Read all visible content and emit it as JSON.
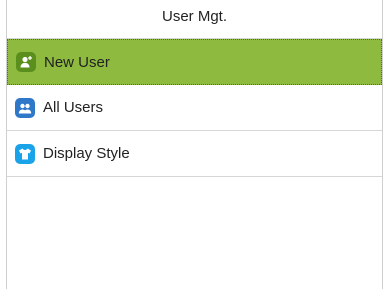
{
  "header": {
    "title": "User Mgt."
  },
  "menu": {
    "items": [
      {
        "label": "New User",
        "icon": "add-user-icon",
        "selected": true
      },
      {
        "label": "All Users",
        "icon": "users-icon",
        "selected": false
      },
      {
        "label": "Display Style",
        "icon": "tshirt-icon",
        "selected": false
      }
    ]
  },
  "colors": {
    "selected_bg": "#8dba3f",
    "icon_green": "#5a8f1d",
    "icon_blue": "#2f77c9",
    "icon_cyan": "#1aa3e8"
  }
}
